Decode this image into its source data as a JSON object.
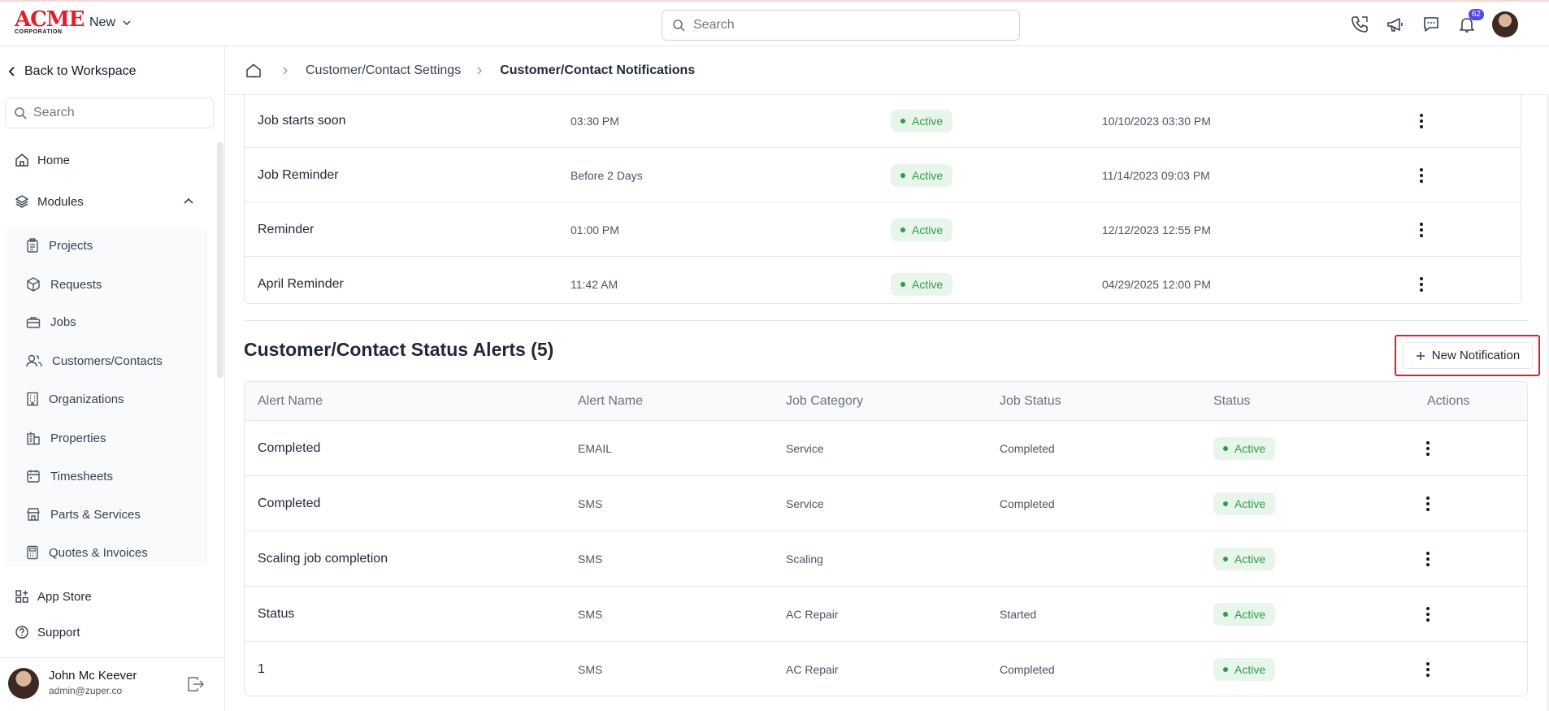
{
  "header": {
    "logo_line1": "ACME",
    "logo_line2": "CORPORATION",
    "new_label": "New",
    "search_placeholder": "Search",
    "notification_count": "62"
  },
  "sidebar": {
    "back_label": "Back to Workspace",
    "search_placeholder": "Search",
    "home": "Home",
    "modules": "Modules",
    "sub_items": [
      "Projects",
      "Requests",
      "Jobs",
      "Customers/Contacts",
      "Organizations",
      "Properties",
      "Timesheets",
      "Parts & Services",
      "Quotes & Invoices"
    ],
    "app_store": "App Store",
    "support": "Support",
    "user_name": "John Mc Keever",
    "user_email": "admin@zuper.co"
  },
  "breadcrumb": {
    "parent": "Customer/Contact Settings",
    "current": "Customer/Contact Notifications"
  },
  "reminders": {
    "rows": [
      {
        "name": "Job starts soon",
        "time": "03:30 PM",
        "status": "Active",
        "date": "10/10/2023 03:30 PM"
      },
      {
        "name": "Job Reminder",
        "time": "Before 2 Days",
        "status": "Active",
        "date": "11/14/2023 09:03 PM"
      },
      {
        "name": "Reminder",
        "time": "01:00 PM",
        "status": "Active",
        "date": "12/12/2023 12:55 PM"
      },
      {
        "name": "April Reminder",
        "time": "11:42 AM",
        "status": "Active",
        "date": "04/29/2025 12:00 PM"
      }
    ]
  },
  "status_alerts": {
    "title": "Customer/Contact Status Alerts (5)",
    "new_button": "New Notification",
    "columns": [
      "Alert Name",
      "Alert Name",
      "Job Category",
      "Job Status",
      "Status",
      "Actions"
    ],
    "rows": [
      {
        "name": "Completed",
        "type": "EMAIL",
        "category": "Service",
        "job_status": "Completed",
        "status": "Active"
      },
      {
        "name": "Completed",
        "type": "SMS",
        "category": "Service",
        "job_status": "Completed",
        "status": "Active"
      },
      {
        "name": "Scaling job completion",
        "type": "SMS",
        "category": "Scaling",
        "job_status": "",
        "status": "Active"
      },
      {
        "name": "Status",
        "type": "SMS",
        "category": "AC Repair",
        "job_status": "Started",
        "status": "Active"
      },
      {
        "name": "1",
        "type": "SMS",
        "category": "AC Repair",
        "job_status": "Completed",
        "status": "Active"
      }
    ]
  },
  "colors": {
    "brand": "#e11d2e",
    "active_green": "#2e9b4a",
    "active_bg": "#e8f5ea",
    "badge": "#4f46e5"
  }
}
